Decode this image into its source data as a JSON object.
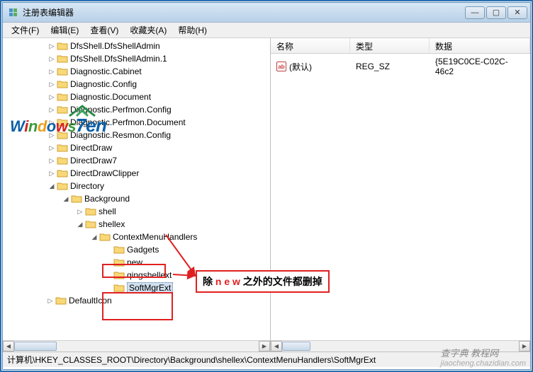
{
  "window": {
    "title": "注册表编辑器",
    "min_label": "—",
    "max_label": "▢",
    "close_label": "✕"
  },
  "menu": {
    "file": "文件(F)",
    "edit": "编辑(E)",
    "view": "查看(V)",
    "favorites": "收藏夹(A)",
    "help": "帮助(H)"
  },
  "tree": {
    "nodes": [
      {
        "label": "DfsShell.DfsShellAdmin",
        "expander": "▷",
        "indent": 2
      },
      {
        "label": "DfsShell.DfsShellAdmin.1",
        "expander": "▷",
        "indent": 2
      },
      {
        "label": "Diagnostic.Cabinet",
        "expander": "▷",
        "indent": 2
      },
      {
        "label": "Diagnostic.Config",
        "expander": "▷",
        "indent": 2
      },
      {
        "label": "Diagnostic.Document",
        "expander": "▷",
        "indent": 2
      },
      {
        "label": "Diagnostic.Perfmon.Config",
        "expander": "▷",
        "indent": 2
      },
      {
        "label": "Diagnostic.Perfmon.Document",
        "expander": "▷",
        "indent": 2
      },
      {
        "label": "Diagnostic.Resmon.Config",
        "expander": "▷",
        "indent": 2
      },
      {
        "label": "DirectDraw",
        "expander": "▷",
        "indent": 2
      },
      {
        "label": "DirectDraw7",
        "expander": "▷",
        "indent": 2
      },
      {
        "label": "DirectDrawClipper",
        "expander": "▷",
        "indent": 2
      },
      {
        "label": "Directory",
        "expander": "◢",
        "indent": 2
      },
      {
        "label": "Background",
        "expander": "◢",
        "indent": 3
      },
      {
        "label": "shell",
        "expander": "▷",
        "indent": 4
      },
      {
        "label": "shellex",
        "expander": "◢",
        "indent": 4
      },
      {
        "label": "ContextMenuHandlers",
        "expander": "◢",
        "indent": 5
      },
      {
        "label": "Gadgets",
        "expander": "",
        "indent": 6,
        "boxed": true
      },
      {
        "label": "new",
        "expander": "",
        "indent": 6
      },
      {
        "label": "qingshellext",
        "expander": "",
        "indent": 6,
        "boxed": true
      },
      {
        "label": "SoftMgrExt",
        "expander": "",
        "indent": 6,
        "boxed": true,
        "selected": true
      }
    ],
    "default_icon_label": "DefaultIcon"
  },
  "list": {
    "headers": {
      "name": "名称",
      "type": "类型",
      "data": "数据"
    },
    "row": {
      "name": "(默认)",
      "type": "REG_SZ",
      "data": "{5E19C0CE-C02C-46c2"
    }
  },
  "annotation": {
    "prefix": "除 ",
    "highlight": "n e w",
    "suffix": " 之外的文件都删掉"
  },
  "statusbar": {
    "path": "计算机\\HKEY_CLASSES_ROOT\\Directory\\Background\\shellex\\ContextMenuHandlers\\SoftMgrExt"
  },
  "watermark": {
    "cn": "查字典 教程网",
    "url": "jiaocheng.chazidian.com"
  },
  "logo": {
    "text": "Windows",
    "seven": "7en"
  }
}
